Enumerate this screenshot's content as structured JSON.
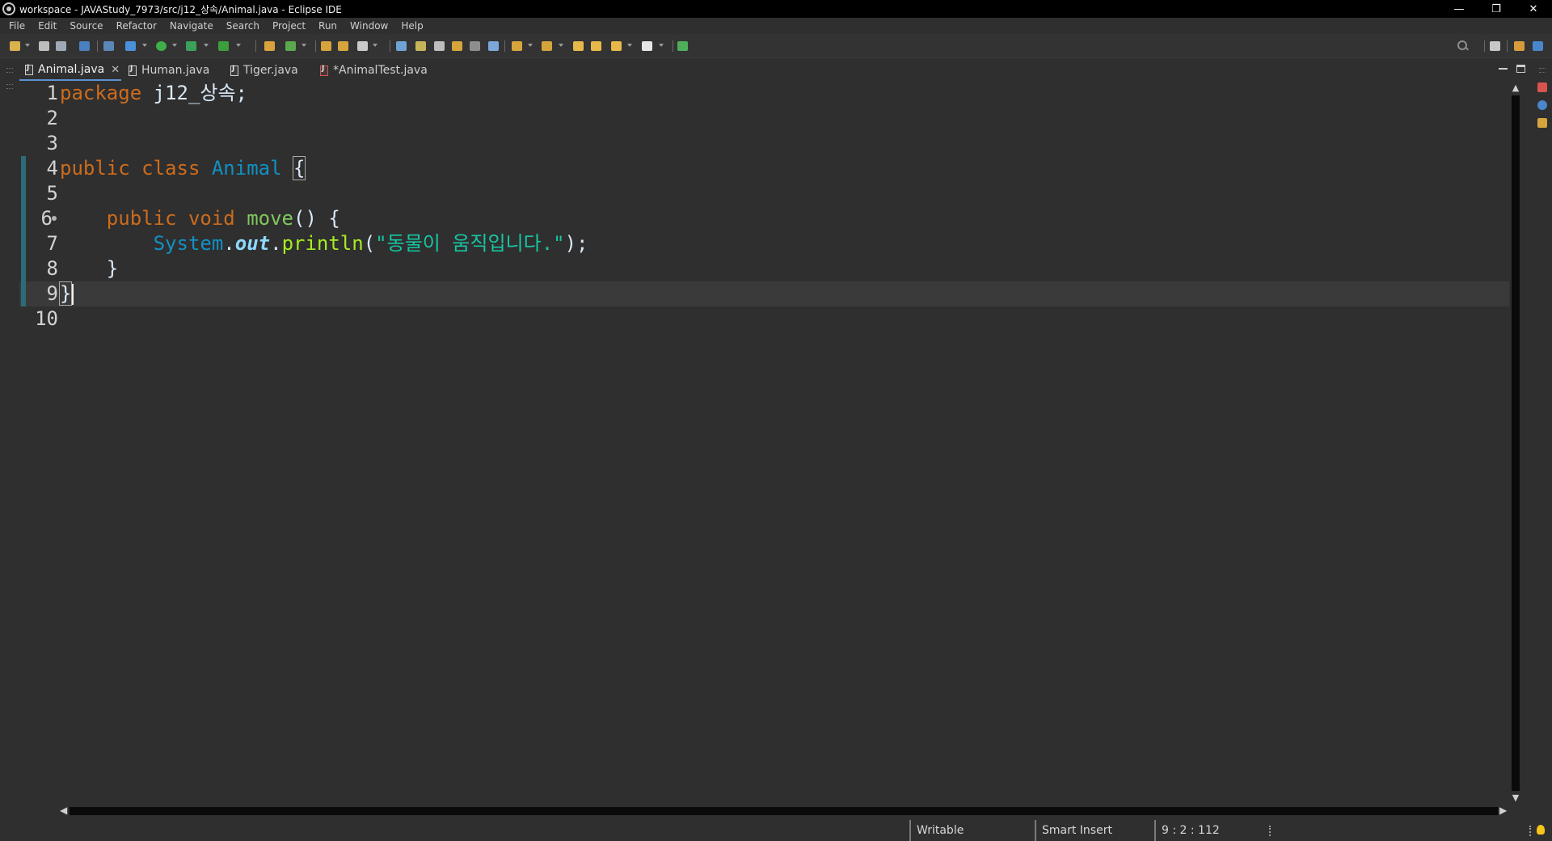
{
  "window": {
    "title": "workspace - JAVAStudy_7973/src/j12_상속/Animal.java - Eclipse IDE",
    "minimize": "—",
    "restore": "❐",
    "close": "✕"
  },
  "menu": {
    "items": [
      "File",
      "Edit",
      "Source",
      "Refactor",
      "Navigate",
      "Search",
      "Project",
      "Run",
      "Window",
      "Help"
    ]
  },
  "tabs": [
    {
      "label": "Animal.java",
      "active": true,
      "dirty": false
    },
    {
      "label": "Human.java",
      "active": false,
      "dirty": false
    },
    {
      "label": "Tiger.java",
      "active": false,
      "dirty": false
    },
    {
      "label": "*AnimalTest.java",
      "active": false,
      "dirty": true
    }
  ],
  "tab_close_glyph": "✕",
  "editor": {
    "line_numbers": [
      "1",
      "2",
      "3",
      "4",
      "5",
      "6",
      "7",
      "8",
      "9",
      "10"
    ],
    "current_line": 9,
    "code": {
      "l1_kw": "package",
      "l1_rest": " j12_상속;",
      "l4_kw": "public class",
      "l4_cls": "Animal",
      "l4_brace": "{",
      "l6_indent": "    ",
      "l6_kw": "public void",
      "l6_meth": "move",
      "l6_rest": "() {",
      "l7_indent": "        ",
      "l7_cls": "System",
      "l7_dot1": ".",
      "l7_field": "out",
      "l7_dot2": ".",
      "l7_call": "println",
      "l7_open": "(",
      "l7_str": "\"동물이 움직입니다.\"",
      "l7_close": ");",
      "l8": "    }",
      "l9": "}"
    }
  },
  "scroll_arrows": {
    "up": "▲",
    "down": "▼",
    "left": "◀",
    "right": "▶"
  },
  "status": {
    "writable": "Writable",
    "insert_mode": "Smart Insert",
    "position": "9 : 2 : 112"
  },
  "colors": {
    "keyword": "#cc6c1d",
    "class": "#1290c3",
    "method_decl": "#80c75e",
    "method_call": "#a7ec21",
    "static_field": "#8dd9fd",
    "string": "#17c6a3",
    "active_tab_underline": "#5b93d4"
  }
}
